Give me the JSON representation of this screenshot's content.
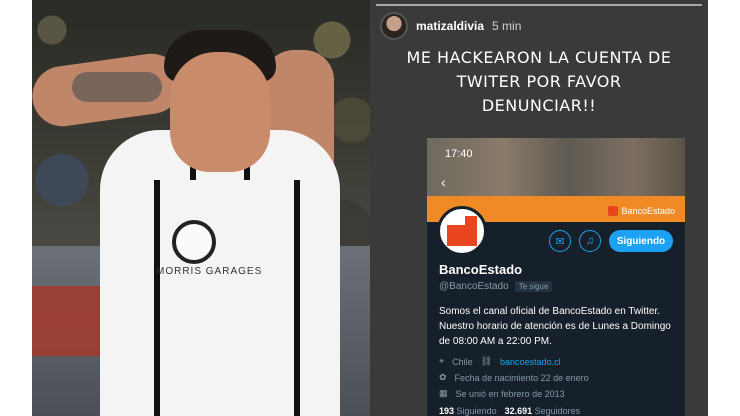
{
  "photo": {
    "shirt_text": "MORRIS GARAGES"
  },
  "story": {
    "username": "matizaldivia",
    "time": "5 min",
    "caption_lines": [
      "ME HACKEARON LA CUENTA DE",
      "TWITER POR FAVOR",
      "DENUNCIAR!!"
    ]
  },
  "twitter": {
    "status_time": "17:40",
    "cover_brand": "BancoEstado",
    "follow_button": "Siguiendo",
    "name": "BancoEstado",
    "handle": "@BancoEstado",
    "follows_you": "Te sigue",
    "bio": "Somos el canal oficial de BancoEstado en Twitter. Nuestro horario de atención es de Lunes a Domingo de 08:00 AM a 22:00 PM.",
    "location": "Chile",
    "website": "bancoestado.cl",
    "birthday": "Fecha de nacimiento 22 de enero",
    "joined": "Se unió en febrero de 2013",
    "following_count": "193",
    "following_label": "Siguiendo",
    "followers_count": "32.691",
    "followers_label": "Seguidores",
    "colors": {
      "accent": "#1da1f2",
      "brand": "#f08a24",
      "background": "#15202b"
    }
  }
}
